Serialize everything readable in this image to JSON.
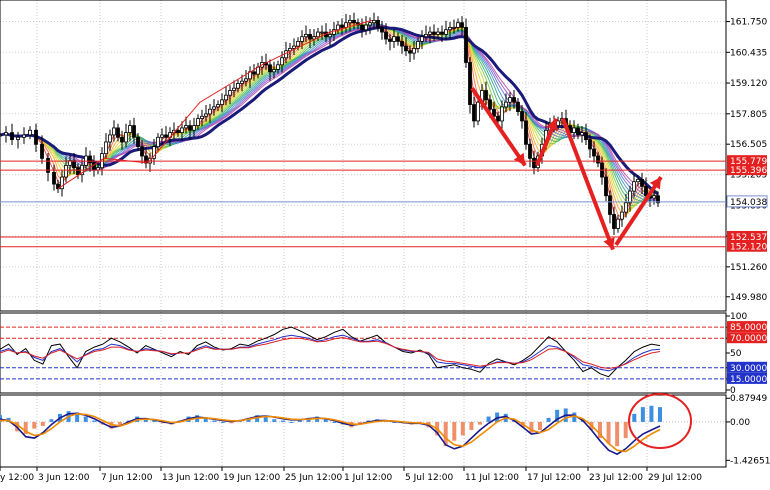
{
  "chart_data": [
    {
      "type": "candlestick",
      "panel": "price",
      "y_ticks": [
        "161.750",
        "160.435",
        "159.120",
        "157.805",
        "156.505",
        "155.205",
        "153.890",
        "152.575",
        "151.260",
        "149.980"
      ],
      "ylim": [
        149.5,
        162.5
      ],
      "price_label": {
        "text": "154.038",
        "value": 154.038
      },
      "levels": [
        {
          "label": "155.779",
          "value": 155.779
        },
        {
          "label": "155.396",
          "value": 155.396
        },
        {
          "label": "152.537",
          "value": 152.537
        },
        {
          "label": "152.120",
          "value": 152.12
        }
      ],
      "close_path": [
        [
          0,
          156.9
        ],
        [
          6,
          157.0
        ],
        [
          12,
          156.7
        ],
        [
          18,
          156.8
        ],
        [
          24,
          156.9
        ],
        [
          30,
          157.1
        ],
        [
          36,
          156.5
        ],
        [
          42,
          155.9
        ],
        [
          48,
          155.3
        ],
        [
          54,
          154.8
        ],
        [
          58,
          154.6
        ],
        [
          62,
          155.1
        ],
        [
          66,
          155.6
        ],
        [
          70,
          155.8
        ],
        [
          74,
          155.5
        ],
        [
          78,
          155.2
        ],
        [
          82,
          155.6
        ],
        [
          86,
          156.0
        ],
        [
          90,
          155.7
        ],
        [
          94,
          155.4
        ],
        [
          98,
          155.5
        ],
        [
          102,
          156.1
        ],
        [
          106,
          156.6
        ],
        [
          110,
          156.9
        ],
        [
          114,
          157.2
        ],
        [
          118,
          156.8
        ],
        [
          122,
          156.6
        ],
        [
          126,
          157.0
        ],
        [
          130,
          157.3
        ],
        [
          134,
          156.8
        ],
        [
          138,
          156.4
        ],
        [
          142,
          156.0
        ],
        [
          146,
          155.7
        ],
        [
          150,
          155.9
        ],
        [
          154,
          156.4
        ],
        [
          158,
          156.8
        ],
        [
          162,
          156.9
        ],
        [
          166,
          156.8
        ],
        [
          170,
          157.0
        ],
        [
          174,
          157.1
        ],
        [
          178,
          157.0
        ],
        [
          182,
          157.2
        ],
        [
          186,
          157.3
        ],
        [
          190,
          157.1
        ],
        [
          194,
          157.3
        ],
        [
          198,
          157.6
        ],
        [
          202,
          157.7
        ],
        [
          206,
          157.8
        ],
        [
          210,
          158.0
        ],
        [
          214,
          158.1
        ],
        [
          218,
          158.2
        ],
        [
          222,
          158.4
        ],
        [
          226,
          158.6
        ],
        [
          230,
          158.8
        ],
        [
          234,
          158.9
        ],
        [
          238,
          159.1
        ],
        [
          242,
          159.2
        ],
        [
          246,
          159.3
        ],
        [
          250,
          159.6
        ],
        [
          254,
          159.5
        ],
        [
          258,
          159.8
        ],
        [
          262,
          160.0
        ],
        [
          266,
          159.9
        ],
        [
          270,
          159.6
        ],
        [
          274,
          159.7
        ],
        [
          278,
          159.9
        ],
        [
          282,
          160.2
        ],
        [
          286,
          160.5
        ],
        [
          290,
          160.6
        ],
        [
          294,
          160.7
        ],
        [
          298,
          160.9
        ],
        [
          302,
          161.1
        ],
        [
          306,
          161.2
        ],
        [
          310,
          161.0
        ],
        [
          314,
          161.1
        ],
        [
          318,
          161.3
        ],
        [
          322,
          161.3
        ],
        [
          326,
          161.1
        ],
        [
          330,
          161.2
        ],
        [
          334,
          161.4
        ],
        [
          338,
          161.6
        ],
        [
          342,
          161.5
        ],
        [
          346,
          161.7
        ],
        [
          350,
          161.8
        ],
        [
          354,
          161.7
        ],
        [
          358,
          161.6
        ],
        [
          362,
          161.4
        ],
        [
          366,
          161.6
        ],
        [
          370,
          161.7
        ],
        [
          374,
          161.8
        ],
        [
          378,
          161.5
        ],
        [
          382,
          161.3
        ],
        [
          386,
          161.0
        ],
        [
          390,
          160.9
        ],
        [
          394,
          161.1
        ],
        [
          398,
          160.9
        ],
        [
          402,
          160.7
        ],
        [
          406,
          160.5
        ],
        [
          410,
          160.4
        ],
        [
          414,
          160.6
        ],
        [
          418,
          160.9
        ],
        [
          422,
          161.1
        ],
        [
          426,
          161.2
        ],
        [
          430,
          161.3
        ],
        [
          434,
          161.2
        ],
        [
          438,
          161.3
        ],
        [
          442,
          161.2
        ],
        [
          446,
          161.4
        ],
        [
          450,
          161.5
        ],
        [
          454,
          161.5
        ],
        [
          458,
          161.7
        ],
        [
          462,
          161.5
        ],
        [
          466,
          160.0
        ],
        [
          470,
          158.2
        ],
        [
          474,
          157.5
        ],
        [
          478,
          158.3
        ],
        [
          482,
          158.8
        ],
        [
          486,
          158.4
        ],
        [
          490,
          158.0
        ],
        [
          494,
          157.7
        ],
        [
          498,
          157.5
        ],
        [
          502,
          158.1
        ],
        [
          506,
          158.3
        ],
        [
          510,
          158.5
        ],
        [
          514,
          158.3
        ],
        [
          518,
          157.9
        ],
        [
          522,
          157.5
        ],
        [
          526,
          156.5
        ],
        [
          530,
          155.9
        ],
        [
          534,
          155.5
        ],
        [
          538,
          156.0
        ],
        [
          542,
          156.5
        ],
        [
          546,
          157.1
        ],
        [
          550,
          157.4
        ],
        [
          554,
          157.3
        ],
        [
          558,
          157.5
        ],
        [
          562,
          157.6
        ],
        [
          566,
          157.3
        ],
        [
          570,
          157.0
        ],
        [
          574,
          157.2
        ],
        [
          578,
          156.9
        ],
        [
          582,
          157.0
        ],
        [
          586,
          156.7
        ],
        [
          590,
          156.3
        ],
        [
          594,
          156.0
        ],
        [
          598,
          155.7
        ],
        [
          602,
          155.1
        ],
        [
          606,
          154.3
        ],
        [
          610,
          153.5
        ],
        [
          614,
          152.9
        ],
        [
          618,
          153.3
        ],
        [
          622,
          153.6
        ],
        [
          626,
          154.0
        ],
        [
          630,
          154.5
        ],
        [
          634,
          154.9
        ],
        [
          638,
          155.0
        ],
        [
          642,
          154.7
        ],
        [
          646,
          154.3
        ],
        [
          650,
          154.2
        ],
        [
          654,
          154.3
        ],
        [
          658,
          154.0
        ]
      ],
      "red_arrows": [
        {
          "from": [
            472,
            158.9
          ],
          "to": [
            525,
            155.6
          ]
        },
        {
          "from": [
            537,
            155.6
          ],
          "to": [
            556,
            157.6
          ]
        },
        {
          "from": [
            563,
            157.6
          ],
          "to": [
            613,
            152.0
          ]
        },
        {
          "from": [
            616,
            152.2
          ],
          "to": [
            661,
            155.1
          ]
        }
      ]
    },
    {
      "type": "line",
      "panel": "oscillator",
      "y_ticks": [
        "100",
        "85.0000",
        "70.0000",
        "50",
        "30.0000",
        "15.0000",
        "0"
      ],
      "ylim": [
        0,
        100
      ],
      "levels": [
        {
          "label": "85.0000",
          "value": 85
        },
        {
          "label": "70.0000",
          "value": 70
        },
        {
          "label": "30.0000",
          "value": 30
        },
        {
          "label": "15.0000",
          "value": 15
        }
      ],
      "series": [
        {
          "color": "#000000",
          "values": [
            55,
            62,
            48,
            56,
            40,
            35,
            60,
            62,
            45,
            30,
            52,
            58,
            62,
            70,
            65,
            58,
            50,
            60,
            55,
            50,
            45,
            52,
            48,
            60,
            65,
            58,
            54,
            56,
            62,
            60,
            66,
            70,
            75,
            82,
            85,
            80,
            74,
            68,
            72,
            78,
            82,
            72,
            66,
            70,
            74,
            64,
            58,
            52,
            50,
            54,
            48,
            30,
            32,
            34,
            30,
            28,
            24,
            36,
            42,
            38,
            34,
            40,
            48,
            60,
            72,
            65,
            52,
            40,
            25,
            30,
            22,
            18,
            30,
            40,
            52,
            58,
            62,
            60
          ]
        },
        {
          "color": "#2233cc",
          "values": [
            52,
            56,
            50,
            52,
            44,
            40,
            52,
            56,
            48,
            38,
            48,
            54,
            56,
            62,
            60,
            55,
            52,
            56,
            54,
            52,
            48,
            50,
            50,
            56,
            60,
            56,
            55,
            55,
            58,
            58,
            62,
            65,
            68,
            72,
            74,
            72,
            70,
            66,
            68,
            72,
            74,
            70,
            66,
            66,
            68,
            64,
            58,
            54,
            52,
            52,
            50,
            38,
            36,
            36,
            34,
            32,
            30,
            34,
            38,
            38,
            36,
            38,
            44,
            52,
            60,
            58,
            52,
            44,
            34,
            32,
            28,
            26,
            30,
            36,
            44,
            50,
            54,
            55
          ]
        },
        {
          "color": "#dd2222",
          "values": [
            50,
            54,
            50,
            51,
            46,
            43,
            50,
            54,
            48,
            42,
            47,
            52,
            54,
            58,
            58,
            54,
            52,
            54,
            53,
            52,
            49,
            50,
            50,
            54,
            58,
            55,
            55,
            55,
            57,
            57,
            60,
            62,
            65,
            68,
            70,
            70,
            68,
            65,
            66,
            69,
            71,
            68,
            65,
            65,
            66,
            63,
            58,
            55,
            53,
            52,
            51,
            42,
            39,
            38,
            36,
            34,
            32,
            34,
            37,
            37,
            36,
            37,
            41,
            48,
            55,
            56,
            52,
            46,
            38,
            35,
            31,
            29,
            31,
            35,
            41,
            46,
            50,
            52
          ]
        }
      ]
    },
    {
      "type": "bar",
      "panel": "histogram",
      "y_ticks": [
        "0.87949",
        "0.00",
        "-1.42651"
      ],
      "ylim": [
        -1.6,
        1.0
      ],
      "bar_colors": {
        "up": "#3d8fe0",
        "down": "#f0906a"
      },
      "values": [
        0.25,
        0.15,
        -0.35,
        -0.45,
        -0.25,
        -0.15,
        0.1,
        0.3,
        0.4,
        0.35,
        0.2,
        0.05,
        -0.1,
        -0.25,
        -0.15,
        0.05,
        0.2,
        0.15,
        0.1,
        -0.05,
        -0.1,
        0.05,
        0.2,
        0.25,
        0.15,
        0.05,
        0.0,
        -0.05,
        0.05,
        0.15,
        0.25,
        0.2,
        0.1,
        0.05,
        0.0,
        0.05,
        0.15,
        0.2,
        0.1,
        0.0,
        -0.1,
        -0.2,
        -0.1,
        0.05,
        0.1,
        0.05,
        0.0,
        -0.05,
        -0.1,
        -0.05,
        -0.2,
        -0.5,
        -0.9,
        -0.7,
        -0.5,
        -0.3,
        -0.1,
        0.2,
        0.35,
        0.3,
        0.1,
        -0.2,
        -0.4,
        -0.3,
        0.15,
        0.45,
        0.5,
        0.35,
        0.1,
        -0.3,
        -0.6,
        -0.8,
        -0.9,
        -0.6,
        0.3,
        0.55,
        0.6,
        0.55
      ],
      "series": [
        {
          "color": "#1a1a8c",
          "values": [
            0.1,
            0.05,
            -0.2,
            -0.55,
            -0.6,
            -0.4,
            -0.1,
            0.15,
            0.3,
            0.32,
            0.25,
            0.12,
            -0.05,
            -0.2,
            -0.15,
            0.0,
            0.12,
            0.12,
            0.08,
            0.0,
            -0.05,
            0.02,
            0.12,
            0.18,
            0.15,
            0.1,
            0.05,
            0.02,
            0.05,
            0.12,
            0.2,
            0.22,
            0.18,
            0.12,
            0.08,
            0.08,
            0.12,
            0.15,
            0.12,
            0.05,
            -0.05,
            -0.12,
            -0.08,
            0.0,
            0.05,
            0.05,
            0.02,
            -0.02,
            -0.05,
            -0.05,
            -0.12,
            -0.4,
            -0.85,
            -1.0,
            -0.9,
            -0.6,
            -0.3,
            -0.05,
            0.15,
            0.2,
            0.05,
            -0.2,
            -0.45,
            -0.4,
            -0.15,
            0.1,
            0.25,
            0.25,
            0.05,
            -0.3,
            -0.7,
            -1.05,
            -1.2,
            -1.0,
            -0.7,
            -0.45,
            -0.3,
            -0.15
          ]
        },
        {
          "color": "#f08a00",
          "values": [
            0.05,
            0.05,
            -0.1,
            -0.35,
            -0.5,
            -0.45,
            -0.25,
            0.0,
            0.2,
            0.3,
            0.28,
            0.2,
            0.05,
            -0.1,
            -0.15,
            -0.05,
            0.08,
            0.1,
            0.09,
            0.04,
            -0.02,
            0.0,
            0.08,
            0.14,
            0.15,
            0.12,
            0.08,
            0.04,
            0.04,
            0.1,
            0.16,
            0.2,
            0.19,
            0.15,
            0.1,
            0.09,
            0.1,
            0.13,
            0.13,
            0.08,
            0.0,
            -0.08,
            -0.09,
            -0.03,
            0.02,
            0.04,
            0.03,
            0.0,
            -0.03,
            -0.04,
            -0.08,
            -0.25,
            -0.6,
            -0.85,
            -0.9,
            -0.75,
            -0.5,
            -0.25,
            0.0,
            0.15,
            0.1,
            -0.08,
            -0.3,
            -0.4,
            -0.28,
            -0.05,
            0.15,
            0.22,
            0.12,
            -0.12,
            -0.45,
            -0.8,
            -1.05,
            -1.1,
            -0.9,
            -0.65,
            -0.45,
            -0.28
          ]
        }
      ],
      "highlight_ellipse": {
        "cx": 660,
        "cy": 421,
        "rx": 31,
        "ry": 27,
        "color": "#e52020"
      }
    },
    {
      "type": "axis",
      "panel": "time",
      "x_ticks": [
        {
          "label": "y 12:00",
          "x": 0
        },
        {
          "label": "3 Jun 12:00",
          "x": 37
        },
        {
          "label": "7 Jun 12:00",
          "x": 100
        },
        {
          "label": "13 Jun 12:00",
          "x": 161
        },
        {
          "label": "19 Jun 12:00",
          "x": 222
        },
        {
          "label": "25 Jun 12:00",
          "x": 284
        },
        {
          "label": "1 Jul 12:00",
          "x": 343
        },
        {
          "label": "5 Jul 12:00",
          "x": 404
        },
        {
          "label": "11 Jul 12:00",
          "x": 464
        },
        {
          "label": "17 Jul 12:00",
          "x": 526
        },
        {
          "label": "23 Jul 12:00",
          "x": 588
        },
        {
          "label": "29 Jul 12:00",
          "x": 647
        }
      ]
    }
  ]
}
